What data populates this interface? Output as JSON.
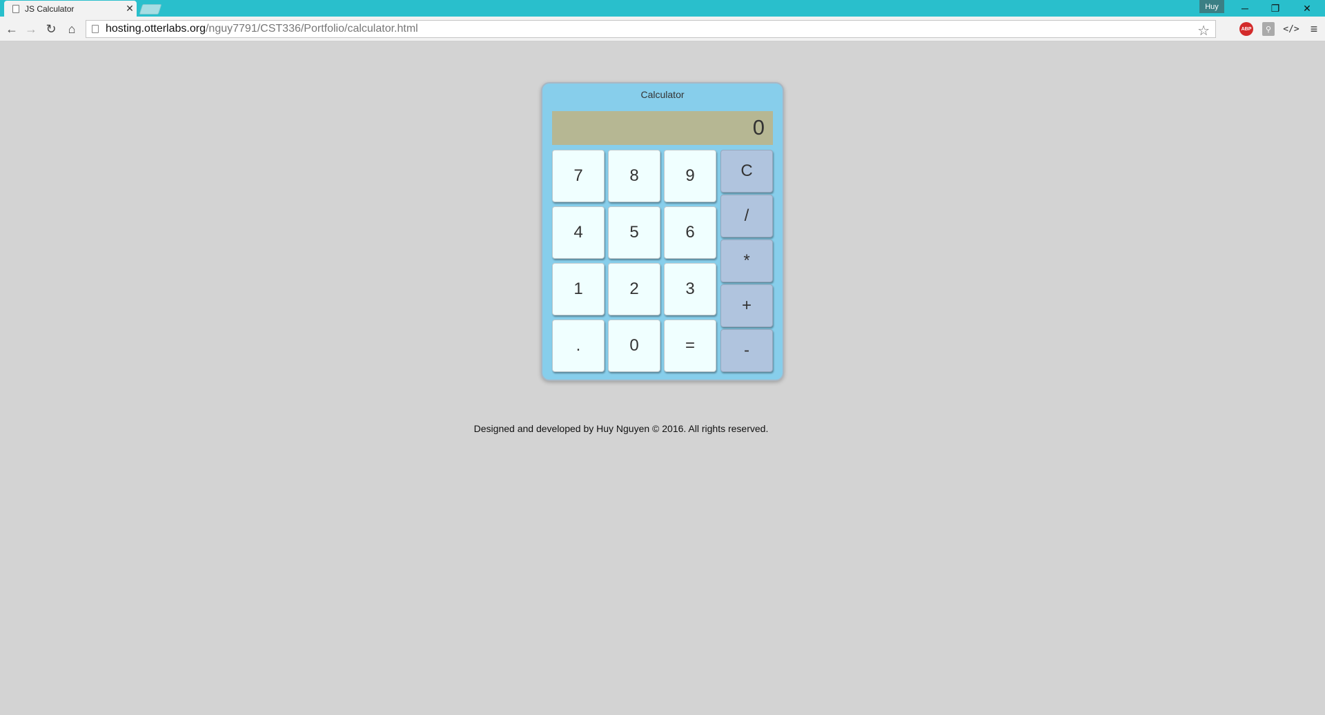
{
  "browser": {
    "tab_title": "JS Calculator",
    "tab_close": "✕",
    "profile_name": "Huy",
    "window_controls": {
      "minimize": "─",
      "restore": "❐",
      "close": "✕"
    },
    "nav": {
      "back": "←",
      "forward": "→",
      "reload": "↻",
      "home": "⌂"
    },
    "url_host": "hosting.otterlabs.org",
    "url_path": "/nguy7791/CST336/Portfolio/calculator.html",
    "bookmark_star": "☆",
    "extensions": {
      "adblock": "ABP",
      "ext2": "⚲",
      "ext3": "</>"
    },
    "menu": "≡"
  },
  "calculator": {
    "title": "Calculator",
    "display": "0",
    "number_keys": [
      "7",
      "8",
      "9",
      "4",
      "5",
      "6",
      "1",
      "2",
      "3",
      ".",
      "0",
      "="
    ],
    "operator_keys": [
      "C",
      "/",
      "*",
      "+",
      "-"
    ]
  },
  "footer": {
    "text": "Designed and developed by Huy Nguyen © 2016. All rights reserved."
  },
  "colors": {
    "titlebar": "#29bfcc",
    "page_background": "#d3d3d3",
    "calculator_body": "#87ceeb",
    "display_background": "#b6b793",
    "number_key": "#f0ffff",
    "operator_key": "#b0c4de"
  }
}
